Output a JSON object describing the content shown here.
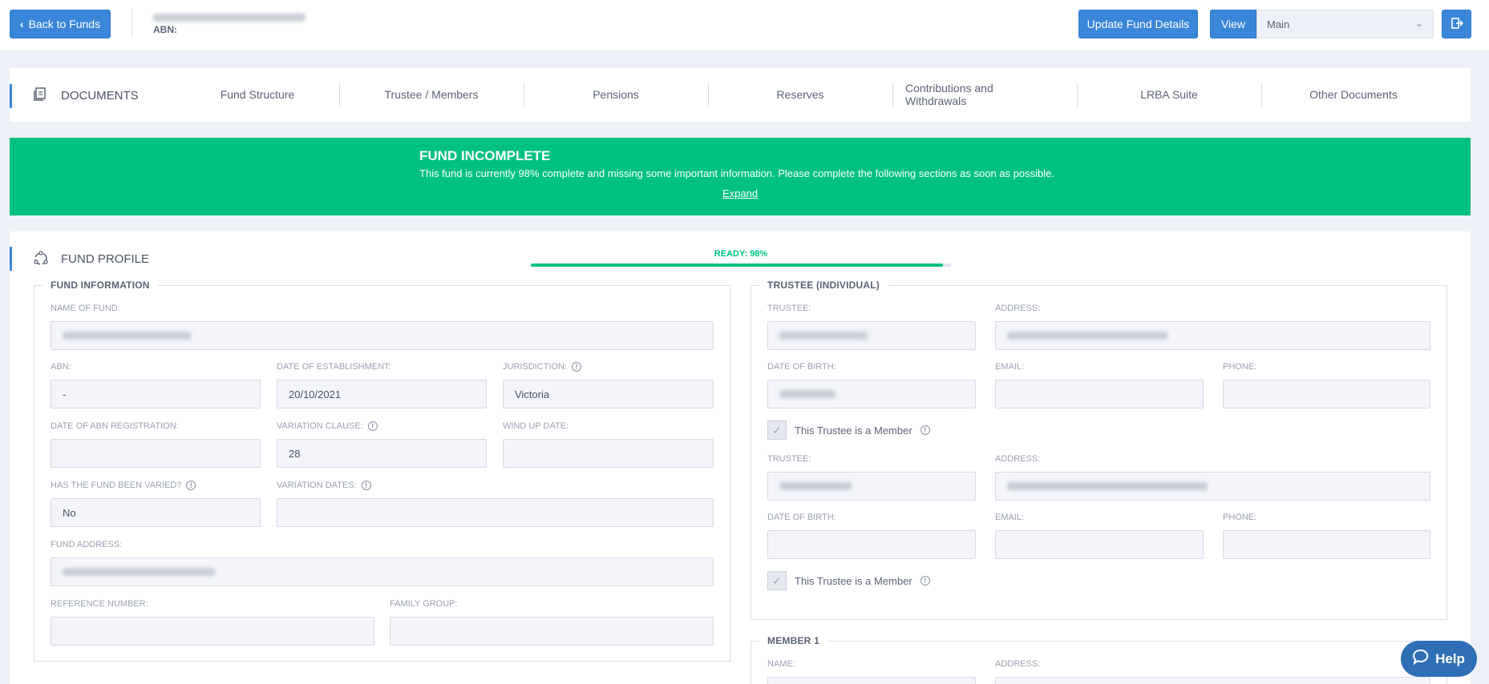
{
  "header": {
    "back_label": "Back to Funds",
    "abn_label": "ABN:",
    "update_label": "Update Fund Details",
    "view_label": "View",
    "view_selected": "Main"
  },
  "docs": {
    "title": "DOCUMENTS",
    "tabs": [
      "Fund Structure",
      "Trustee / Members",
      "Pensions",
      "Reserves",
      "Contributions and Withdrawals",
      "LRBA Suite",
      "Other Documents"
    ]
  },
  "banner": {
    "title": "FUND INCOMPLETE",
    "message": "This fund is currently 98% complete and missing some important information. Please complete the following sections as soon as possible.",
    "expand": "Expand",
    "accent": "#00c17f"
  },
  "profile": {
    "title": "FUND PROFILE",
    "ready_label": "READY: 98%",
    "progress": 0.98,
    "fund_info": {
      "legend": "FUND INFORMATION",
      "name_label": "NAME OF FUND:",
      "abn_label": "ABN:",
      "abn_value": "-",
      "est_label": "DATE OF ESTABLISHMENT:",
      "est_value": "20/10/2021",
      "jur_label": "JURISDICTION:",
      "jur_value": "Victoria",
      "abnreg_label": "DATE OF ABN REGISTRATION:",
      "varclause_label": "VARIATION CLAUSE:",
      "varclause_value": "28",
      "windup_label": "WIND UP DATE:",
      "varied_label": "HAS THE FUND BEEN VARIED?",
      "varied_value": "No",
      "vardates_label": "VARIATION DATES:",
      "address_label": "FUND ADDRESS:",
      "ref_label": "REFERENCE NUMBER:",
      "family_label": "FAMILY GROUP:"
    },
    "trustee": {
      "legend": "TRUSTEE (INDIVIDUAL)",
      "trustee_label": "TRUSTEE:",
      "address_label": "ADDRESS:",
      "dob_label": "DATE OF BIRTH:",
      "email_label": "EMAIL:",
      "phone_label": "PHONE:",
      "member_label": "This Trustee is a Member"
    },
    "member1": {
      "legend": "MEMBER 1",
      "name_label": "NAME:",
      "address_label": "ADDRESS:"
    }
  },
  "help_label": "Help"
}
